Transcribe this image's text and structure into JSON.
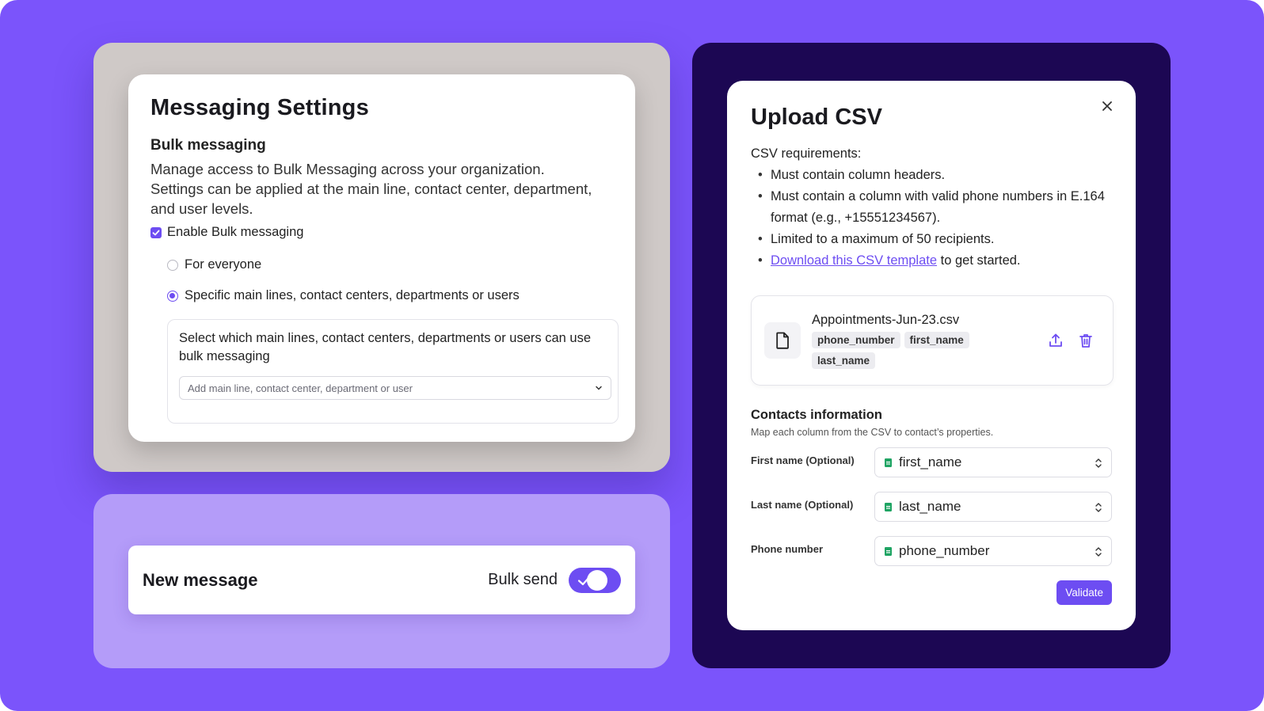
{
  "settings": {
    "title": "Messaging Settings",
    "section_title": "Bulk messaging",
    "description": "Manage access to Bulk Messaging across your organization. Settings can be applied at the main line, contact center, department, and user levels.",
    "enable_label": "Enable Bulk messaging",
    "enable_checked": true,
    "radio_everyone": "For everyone",
    "radio_specific": "Specific main lines, contact centers, departments or users",
    "selected_radio": "specific",
    "select_prompt": "Select which main lines, contact centers, departments or users can use bulk messaging",
    "select_placeholder": "Add main line, contact center, department or user"
  },
  "new_message": {
    "title": "New message",
    "bulk_send_label": "Bulk send",
    "bulk_send_on": true
  },
  "upload": {
    "title": "Upload CSV",
    "requirements_title": "CSV requirements:",
    "requirements": [
      "Must contain column headers.",
      "Must contain a column with valid phone numbers in E.164 format (e.g., +15551234567).",
      "Limited to a maximum of 50 recipients."
    ],
    "download_link": "Download this CSV template",
    "download_suffix": " to get started.",
    "file": {
      "name": "Appointments-Jun-23.csv",
      "columns": [
        "phone_number",
        "first_name",
        "last_name"
      ]
    },
    "contacts_title": "Contacts information",
    "contacts_subtitle": "Map each column from the CSV to contact’s properties.",
    "mappings": [
      {
        "label": "First name (Optional)",
        "value": "first_name"
      },
      {
        "label": "Last name (Optional)",
        "value": "last_name"
      },
      {
        "label": "Phone number",
        "value": "phone_number"
      }
    ],
    "validate_label": "Validate"
  },
  "colors": {
    "background": "#7b54fb",
    "accent": "#6d4df2",
    "dark_panel": "#1c0753",
    "grey_panel": "#cfc9c7",
    "lilac_panel": "#b49cf9",
    "sheet_green": "#1fa463"
  }
}
